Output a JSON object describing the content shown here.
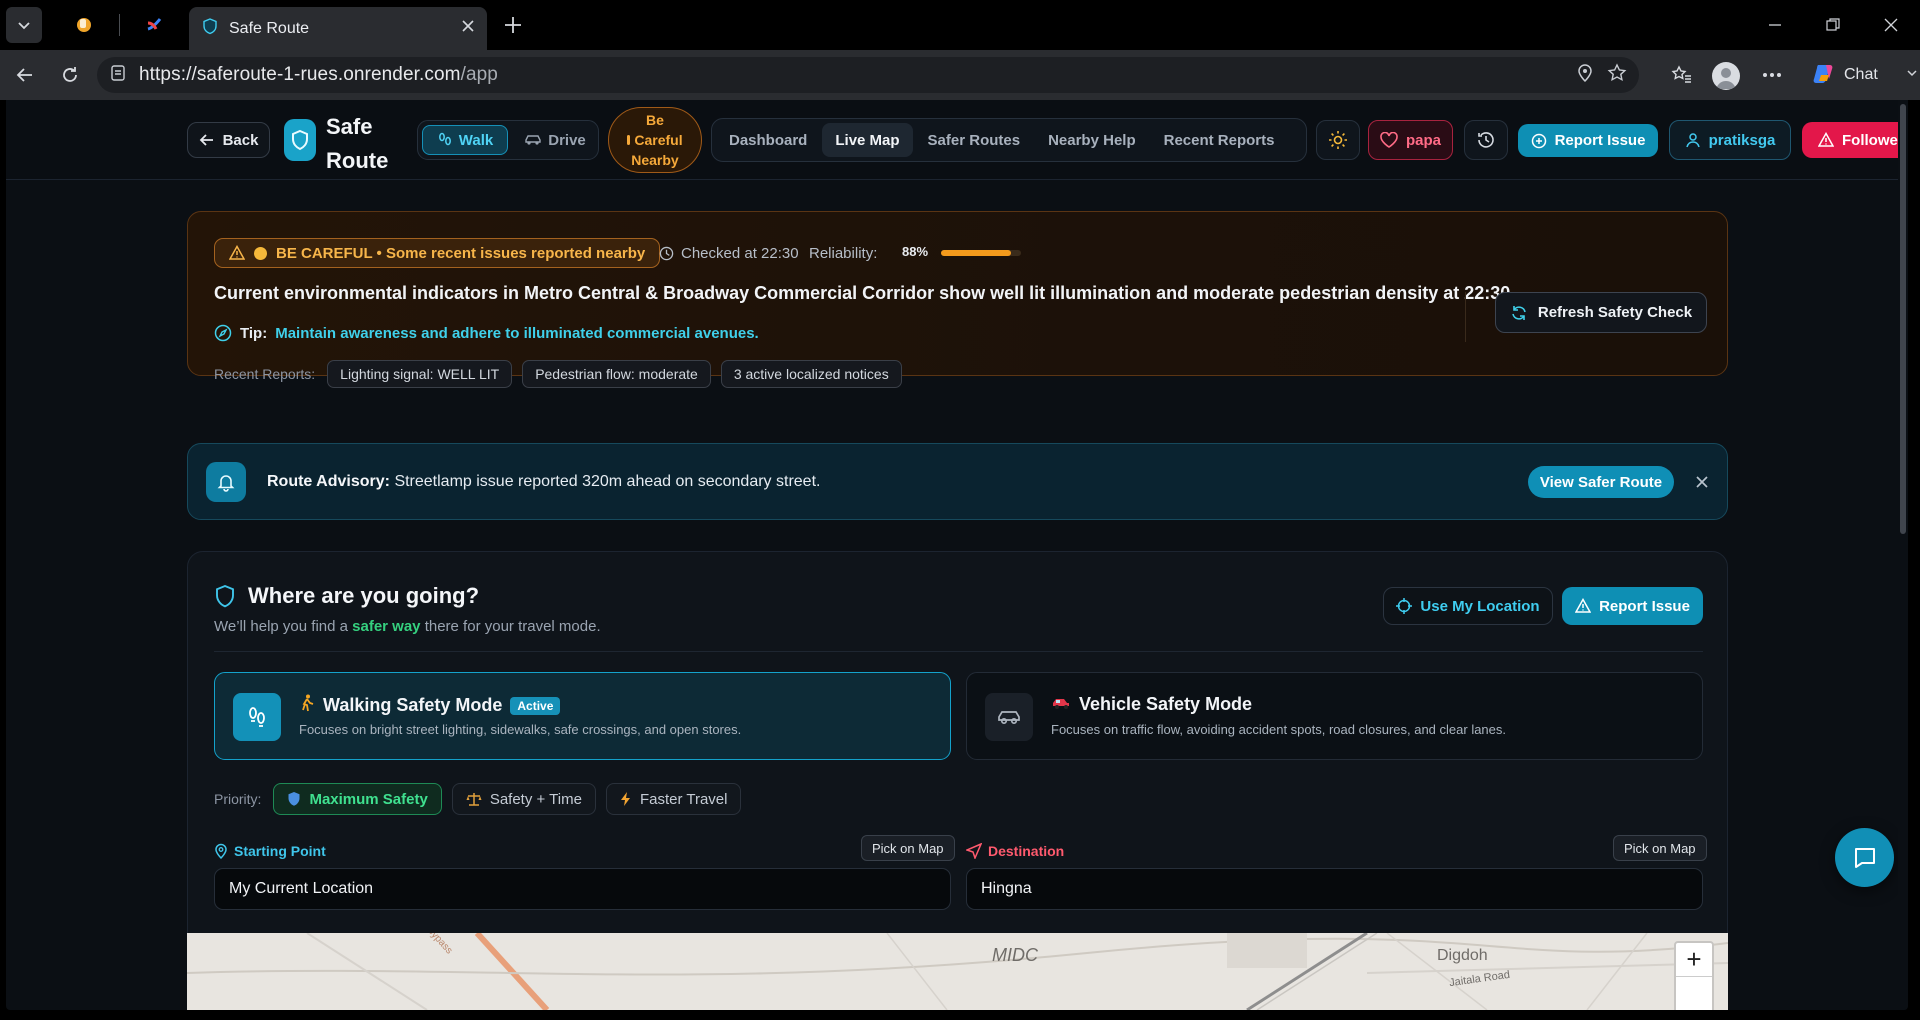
{
  "browser": {
    "tab_title": "Safe Route",
    "url_host": "https://saferoute-1-rues.onrender.com",
    "url_path": "/app",
    "chat_label": "Chat"
  },
  "header": {
    "back_label": "Back",
    "logo_line1": "Safe",
    "logo_line2": "Route",
    "mode_walk": "Walk",
    "mode_drive": "Drive",
    "careful_line1": "Be",
    "careful_line2": "Careful",
    "careful_line3": "Nearby",
    "nav_tabs": [
      "Dashboard",
      "Live Map",
      "Safer Routes",
      "Nearby Help",
      "Recent Reports"
    ],
    "active_tab": "Live Map",
    "contact_label": "papa",
    "report_label": "Report Issue",
    "user_label": "pratiksga",
    "followed_label": "Followed"
  },
  "alert": {
    "badge": "BE CAREFUL • Some recent issues reported nearby",
    "checked": "Checked at 22:30",
    "reliability_label": "Reliability:",
    "reliability_value": "88%",
    "reliability_fraction": 0.88,
    "message": "Current environmental indicators in Metro Central & Broadway Commercial Corridor show well lit illumination and moderate pedestrian density at 22:30.",
    "tip_key": "Tip:",
    "tip_text": "Maintain awareness and adhere to illuminated commercial avenues.",
    "recent_label": "Recent Reports:",
    "recent_chips": [
      "Lighting signal: WELL LIT",
      "Pedestrian flow: moderate",
      "3 active localized notices"
    ],
    "refresh_label": "Refresh Safety Check"
  },
  "advisory": {
    "title": "Route Advisory:",
    "text": "Streetlamp issue reported 320m ahead on secondary street.",
    "button": "View Safer Route"
  },
  "planner": {
    "title": "Where are you going?",
    "sub_pre": "We’ll help you find a",
    "sub_green": "safer way",
    "sub_post": "there for your travel mode.",
    "use_location": "Use My Location",
    "report_label": "Report Issue",
    "walk_title": "Walking Safety Mode",
    "walk_badge": "Active",
    "walk_desc": "Focuses on bright street lighting, sidewalks, safe crossings, and open stores.",
    "drive_title": "Vehicle Safety Mode",
    "drive_desc": "Focuses on traffic flow, avoiding accident spots, road closures, and clear lanes.",
    "priority_label": "Priority:",
    "priorities": [
      "Maximum Safety",
      "Safety + Time",
      "Faster Travel"
    ],
    "start_label": "Starting Point",
    "dest_label": "Destination",
    "pick_label": "Pick on Map",
    "start_value": "My Current Location",
    "dest_value": "Hingna"
  },
  "map": {
    "labels": [
      "MIDC",
      "Digdoh",
      "Jaitala Road",
      "Bypass"
    ],
    "zoom_in": "+"
  },
  "colors": {
    "accent": "#0e8fb4",
    "warning": "#f39a1c",
    "danger": "#e3174a",
    "safe": "#35d07f"
  }
}
